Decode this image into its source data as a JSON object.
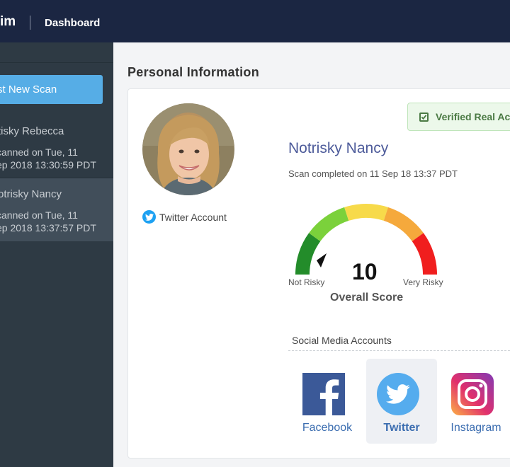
{
  "header": {
    "brand": "im",
    "nav_dashboard": "Dashboard"
  },
  "sidebar": {
    "new_scan_label": "st New Scan",
    "scans": [
      {
        "name": "tisky Rebecca",
        "date_line1": "canned on Tue, 11",
        "date_line2": "ep 2018 13:30:59 PDT"
      },
      {
        "name": "otrisky Nancy",
        "date_line1": "canned on Tue, 11",
        "date_line2": "ep 2018 13:37:57 PDT"
      }
    ]
  },
  "main": {
    "section_title": "Personal Information",
    "account_type": "Twitter Account",
    "verified_label": "Verified Real Ac",
    "person_name": "Notrisky Nancy",
    "scan_completed": "Scan completed on 11 Sep 18 13:37 PDT",
    "gauge": {
      "score": "10",
      "caption": "Overall Score",
      "left_label": "Not Risky",
      "right_label": "Very Risky",
      "segment_colors": [
        "#238c2a",
        "#7bd13b",
        "#f7da4a",
        "#f5a93c",
        "#f01e1e"
      ]
    },
    "social_heading": "Social Media Accounts",
    "social_accounts": [
      {
        "label": "Facebook",
        "icon": "facebook-icon",
        "color": "#3b5998"
      },
      {
        "label": "Twitter",
        "icon": "twitter-icon",
        "color": "#55acee"
      },
      {
        "label": "Instagram",
        "icon": "instagram-icon",
        "color": "#c13584"
      }
    ]
  }
}
